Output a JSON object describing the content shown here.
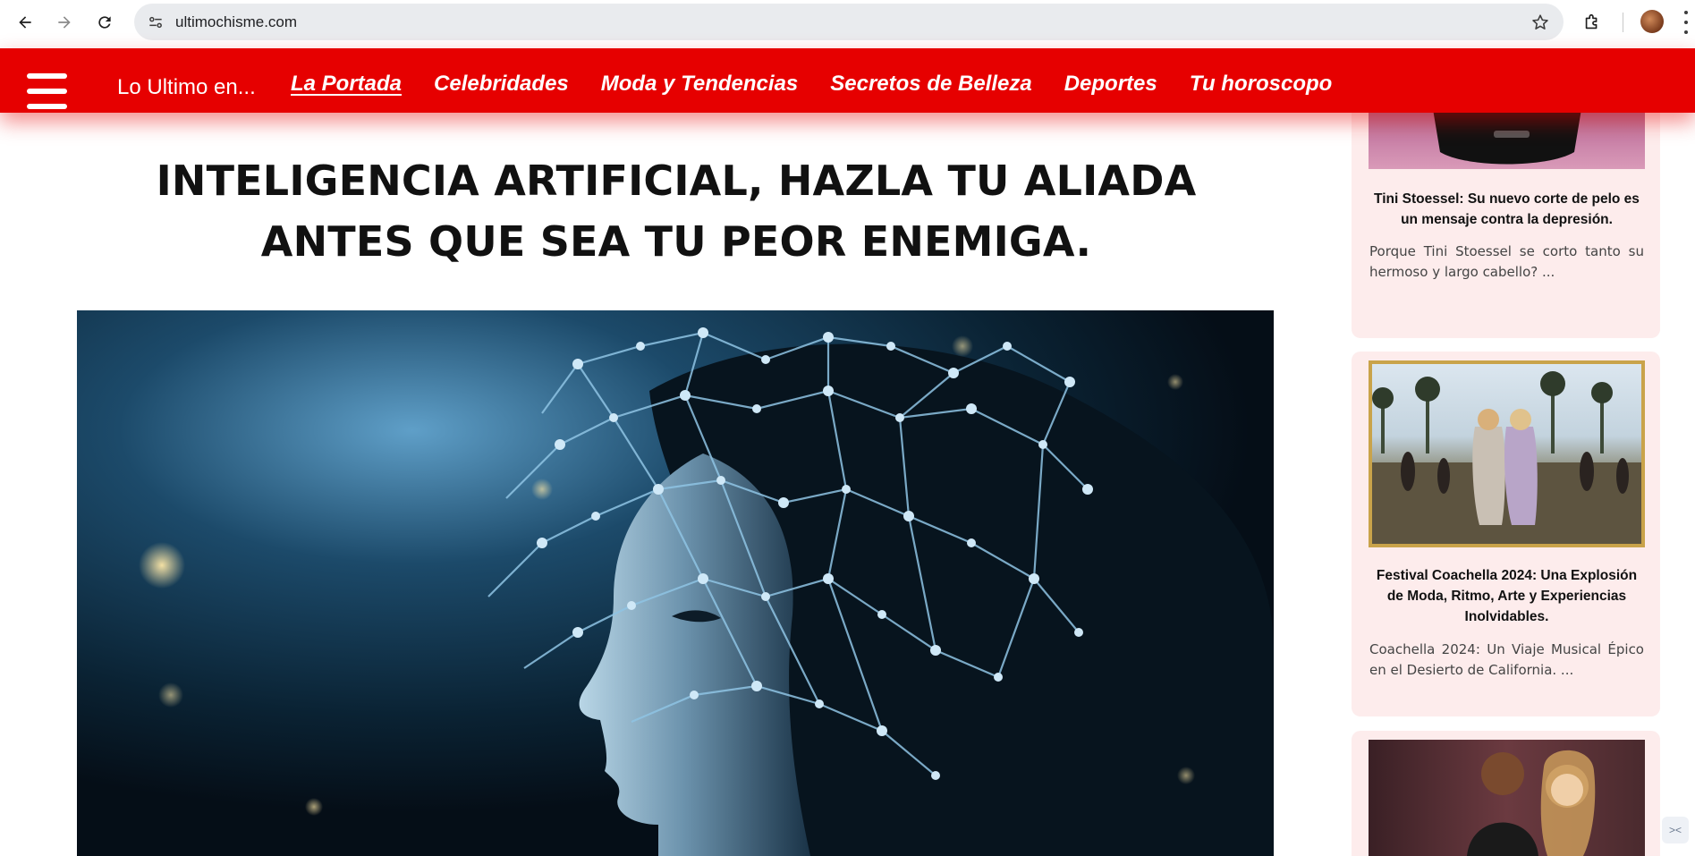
{
  "browser": {
    "url": "ultimochisme.com",
    "icons": {
      "back": "arrow-left-icon",
      "forward": "arrow-right-icon",
      "reload": "reload-icon",
      "site_info": "tune-icon",
      "bookmark": "star-icon",
      "extensions": "puzzle-icon",
      "profile": "avatar",
      "menu": "kebab-menu-icon"
    }
  },
  "header": {
    "brand": "Lo Ultimo en...",
    "menu_icon": "hamburger-icon",
    "background_color": "#e60000",
    "nav": [
      {
        "label": "La Portada",
        "active": true
      },
      {
        "label": "Celebridades",
        "active": false
      },
      {
        "label": "Moda y Tendencias",
        "active": false
      },
      {
        "label": "Secretos de Belleza",
        "active": false
      },
      {
        "label": "Deportes",
        "active": false
      },
      {
        "label": "Tu horoscopo",
        "active": false
      }
    ]
  },
  "article": {
    "title": "INTELIGENCIA ARTIFICIAL, HAZLA TU ALIADA ANTES QUE SEA TU PEOR ENEMIGA.",
    "hero_image": "ai-woman-neural-network-image"
  },
  "sidebar": {
    "cards": [
      {
        "title": "Tini Stoessel: Su nuevo corte de pelo es un mensaje contra la depresión.",
        "excerpt": "Porque Tini Stoessel se corto tanto su hermoso y largo cabello? ..."
      },
      {
        "title": "Festival Coachella 2024: Una Explosión de Moda, Ritmo, Arte y Experiencias Inolvidables.",
        "excerpt": "Coachella 2024: Un Viaje Musical Épico en el Desierto de California. ..."
      },
      {
        "title": "",
        "excerpt": ""
      }
    ],
    "card_background": "#fdecec"
  }
}
